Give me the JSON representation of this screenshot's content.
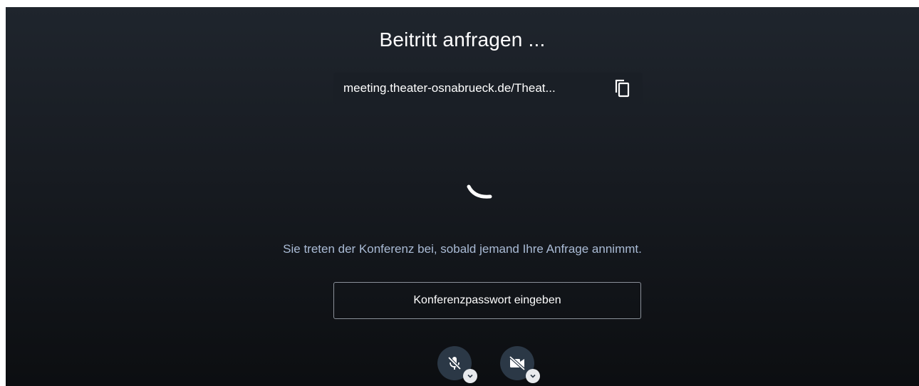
{
  "page": {
    "title": "Beitritt anfragen ...",
    "meeting_url": "meeting.theater-osnabrueck.de/Theat...",
    "message": "Sie treten der Konferenz bei, sobald jemand Ihre Anfrage annimmt.",
    "password_button_label": "Konferenzpasswort eingeben"
  },
  "icons": {
    "copy": "copy-icon",
    "spinner": "loading-spinner-icon",
    "mic": "microphone-muted-icon",
    "camera": "camera-off-icon",
    "chevron": "chevron-down-icon"
  },
  "colors": {
    "background": "#171b21",
    "text": "#ffffff",
    "message_text": "#aabbd5",
    "media_button": "#2b3846"
  }
}
